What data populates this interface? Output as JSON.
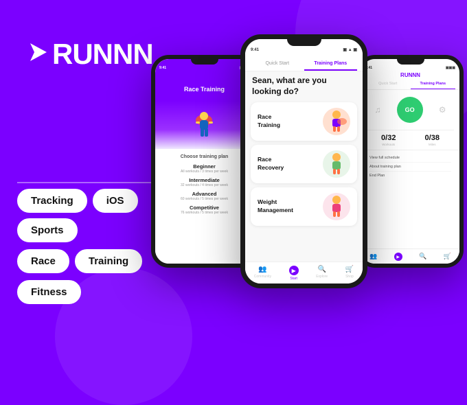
{
  "logo": {
    "text": "RUNNN",
    "arrow": "➤"
  },
  "tags": [
    [
      "Tracking",
      "iOS",
      "Sports"
    ],
    [
      "Race",
      "Training"
    ],
    [
      "Fitness"
    ]
  ],
  "phones": {
    "left": {
      "status_time": "9:41",
      "header_title": "Race Training",
      "choose_plan": "Choose training plan",
      "plans": [
        {
          "name": "Beginner",
          "desc": "All workouts / 3 times per week"
        },
        {
          "name": "Intermediate",
          "desc": "32 workouts / 4 times per week"
        },
        {
          "name": "Advanced",
          "desc": "60 workouts / 5 times per week"
        },
        {
          "name": "Competitive",
          "desc": "76 workouts / 5 times per week"
        }
      ]
    },
    "center": {
      "status_time": "9:41",
      "tabs": [
        "Quick Start",
        "Training Plans"
      ],
      "active_tab": "Training Plans",
      "question": "Sean, what are you looking do?",
      "cards": [
        {
          "title": "Race\nTraining",
          "color": "#FFE0B2"
        },
        {
          "title": "Race\nRecovery",
          "color": "#E8F5E9"
        },
        {
          "title": "Weight\nManagement",
          "color": "#FCE4EC"
        }
      ],
      "nav_items": [
        "Community",
        "Start",
        "Explore",
        "Shop"
      ]
    },
    "right": {
      "status_time": "9:41",
      "logo": "RUNNN",
      "tabs": [
        "Quick Start",
        "Training Plans"
      ],
      "active_tab": "Training Plans",
      "go_button": "GO",
      "stats": [
        {
          "value": "0/32",
          "label": "Workouts"
        },
        {
          "value": "0/38",
          "label": "Miles"
        }
      ],
      "links": [
        "View full schedule",
        "About training plan",
        "End Plan"
      ]
    }
  },
  "colors": {
    "brand": "#7B00FF",
    "go_green": "#2ECC71",
    "white": "#ffffff"
  }
}
